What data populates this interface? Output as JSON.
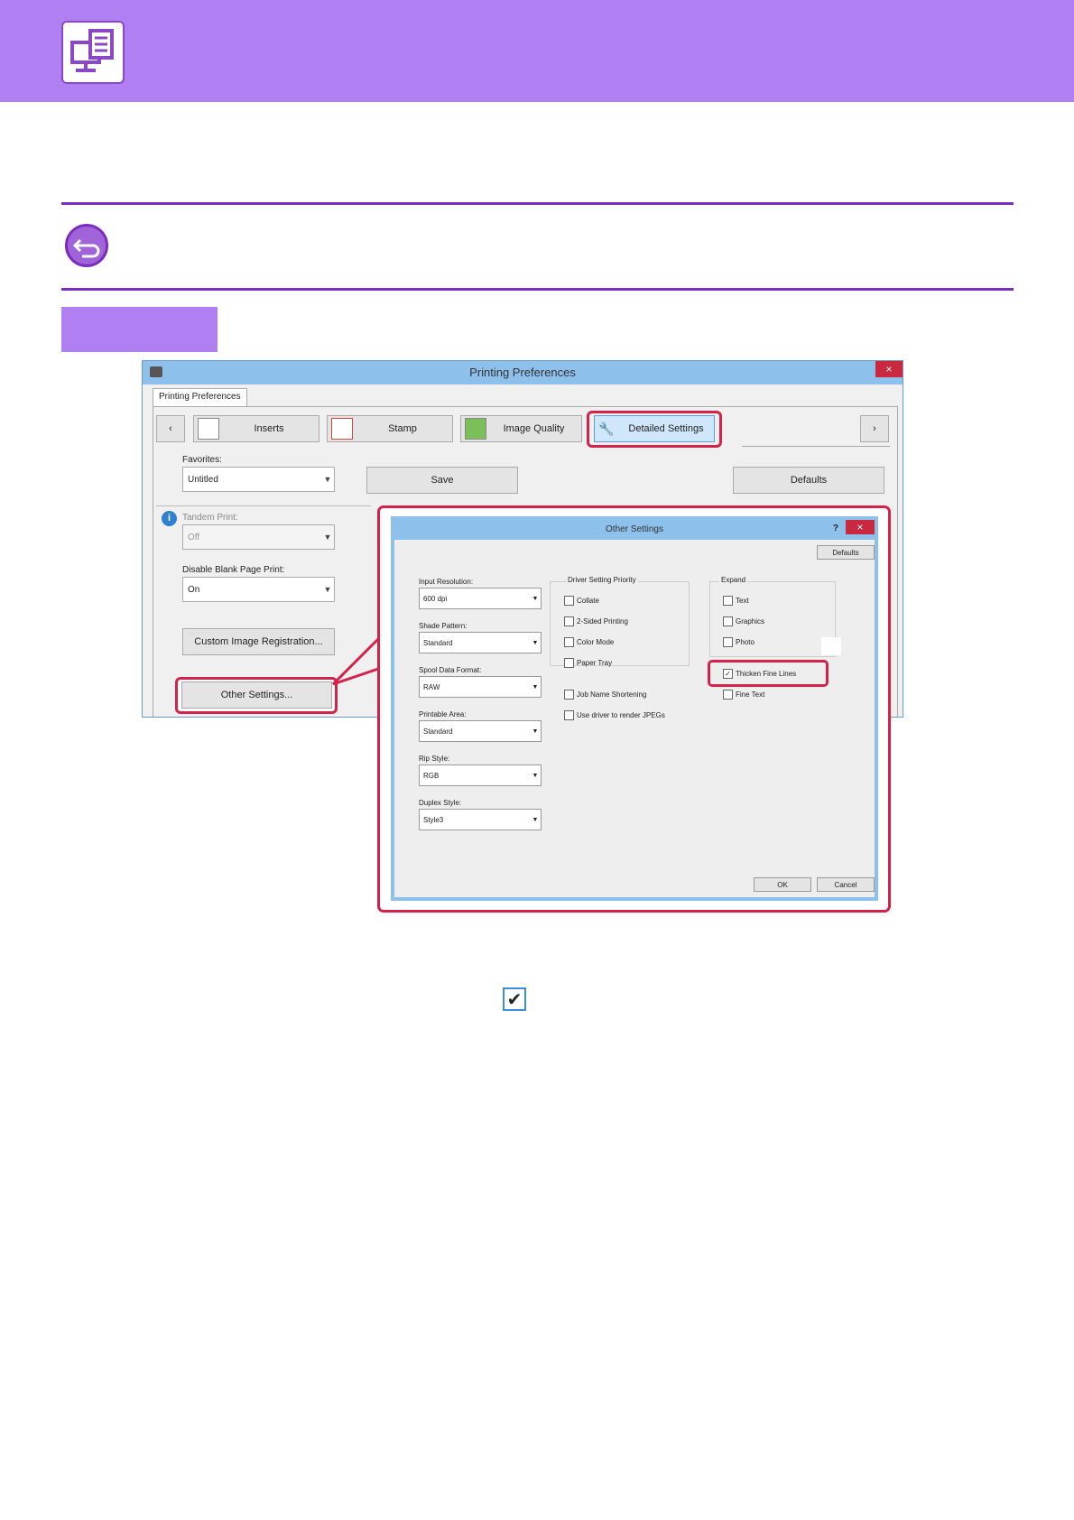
{
  "main_dialog": {
    "title": "Printing Preferences",
    "close_label": "×",
    "tab_strip_label": "Printing Preferences",
    "nav_prev": "‹",
    "nav_next": "›",
    "tabs": [
      {
        "label": "Inserts"
      },
      {
        "label": "Stamp"
      },
      {
        "label": "Image Quality"
      },
      {
        "label": "Detailed Settings"
      }
    ],
    "favorites_label": "Favorites:",
    "favorites_value": "Untitled",
    "save_label": "Save",
    "defaults_label": "Defaults",
    "tandem_label": "Tandem Print:",
    "tandem_value": "Off",
    "blank_page_label": "Disable Blank Page Print:",
    "blank_page_value": "On",
    "custom_image_label": "Custom Image Registration...",
    "other_settings_label": "Other Settings...",
    "info_glyph": "i"
  },
  "other_settings": {
    "title": "Other Settings",
    "help_label": "?",
    "close_label": "×",
    "defaults_label": "Defaults",
    "fields": [
      {
        "label": "Input Resolution:",
        "value": "600 dpi"
      },
      {
        "label": "Shade Pattern:",
        "value": "Standard"
      },
      {
        "label": "Spool Data Format:",
        "value": "RAW"
      },
      {
        "label": "Printable Area:",
        "value": "Standard"
      },
      {
        "label": "Rip Style:",
        "value": "RGB"
      },
      {
        "label": "Duplex Style:",
        "value": "Style3"
      }
    ],
    "driver_priority": {
      "title": "Driver Setting Priority",
      "items": [
        "Collate",
        "2-Sided Printing",
        "Color Mode",
        "Paper Tray"
      ]
    },
    "job_name_shortening": "Job Name Shortening",
    "use_driver_jpeg": "Use driver to render JPEGs",
    "expand": {
      "title": "Expand",
      "items": [
        "Text",
        "Graphics",
        "Photo"
      ]
    },
    "thicken_fine_lines": "Thicken Fine Lines",
    "thicken_checked": true,
    "fine_text": "Fine Text",
    "ok_label": "OK",
    "cancel_label": "Cancel",
    "check_mark": "✓"
  },
  "checked_glyph": "✔",
  "colors": {
    "accent_purple": "#b07ff2",
    "rule_purple": "#7a2ec0",
    "highlight_red": "#d4234a",
    "title_bar_blue": "#8ec0ec"
  }
}
